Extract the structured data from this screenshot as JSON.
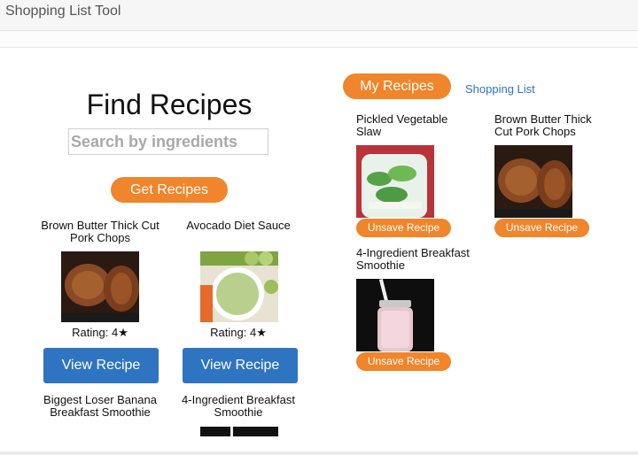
{
  "app": {
    "title": "Shopping List Tool"
  },
  "find": {
    "title": "Find Recipes",
    "search_placeholder": "Search by ingredients",
    "search_value": "",
    "get_button": "Get Recipes"
  },
  "results": [
    {
      "title": "Brown Butter Thick Cut Pork Chops",
      "rating": "Rating: 4★",
      "view": "View Recipe",
      "image_icon": "pork-chops-photo"
    },
    {
      "title": "Avocado Diet Sauce",
      "rating": "Rating: 4★",
      "view": "View Recipe",
      "image_icon": "avocado-sauce-photo"
    },
    {
      "title": "Biggest Loser Banana Breakfast Smoothie"
    },
    {
      "title": "4-Ingredient Breakfast Smoothie"
    }
  ],
  "my_recipes": {
    "tab_label": "My Recipes",
    "shopping_link": "Shopping List",
    "saved": [
      {
        "title": "Pickled Vegetable Slaw",
        "unsave": "Unsave Recipe",
        "image_icon": "pickled-slaw-photo"
      },
      {
        "title": "Brown Butter Thick Cut Pork Chops",
        "unsave": "Unsave Recipe",
        "image_icon": "pork-chops-photo"
      },
      {
        "title": "4-Ingredient Breakfast Smoothie",
        "unsave": "Unsave Recipe",
        "image_icon": "smoothie-photo"
      }
    ]
  },
  "colors": {
    "accent_orange": "#f0852b",
    "primary_blue": "#2f74c0",
    "link_blue": "#2f74c0"
  }
}
